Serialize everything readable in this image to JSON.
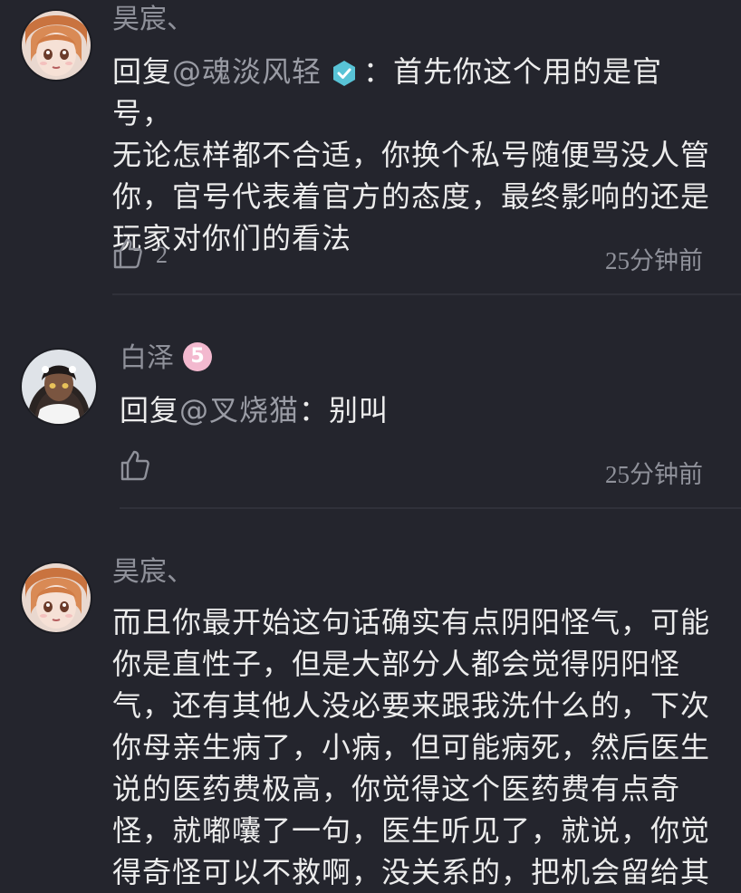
{
  "comments": [
    {
      "username": "昊宸、",
      "reply_prefix": "回复",
      "mention": "@魂淡风轻",
      "text_first": "：首先你这个用的是官号，",
      "text_rest": [
        "无论怎样都不合适，你换个私号随便骂没人管",
        "你，官号代表着官方的态度，最终影响的还是",
        "玩家对你们的看法"
      ],
      "likes": "2",
      "time": "25分钟前"
    },
    {
      "username": "白泽",
      "level": "5",
      "reply_prefix": "回复",
      "mention": "@叉烧猫",
      "text_first": "：别叫",
      "time": "25分钟前"
    },
    {
      "username": "昊宸、",
      "lines": [
        "而且你最开始这句话确实有点阴阳怪气，可能",
        "你是直性子，但是大部分人都会觉得阴阳怪",
        "气，还有其他人没必要来跟我洗什么的，下次",
        "你母亲生病了，小病，但可能病死，然后医生",
        "说的医药费极高，你觉得这个医药费有点奇",
        "怪，就嘟囔了一句，医生听见了，就说，你觉",
        "得奇怪可以不救啊，没关系的，把机会留给其"
      ]
    }
  ],
  "colors": {
    "background": "#24252d",
    "meta_text": "#8f919a",
    "body_text": "#ececec",
    "verified": "#58c3d6",
    "level_badge": "#f3b9cf"
  },
  "icons": [
    "thumbs-up-icon",
    "verified-icon"
  ]
}
